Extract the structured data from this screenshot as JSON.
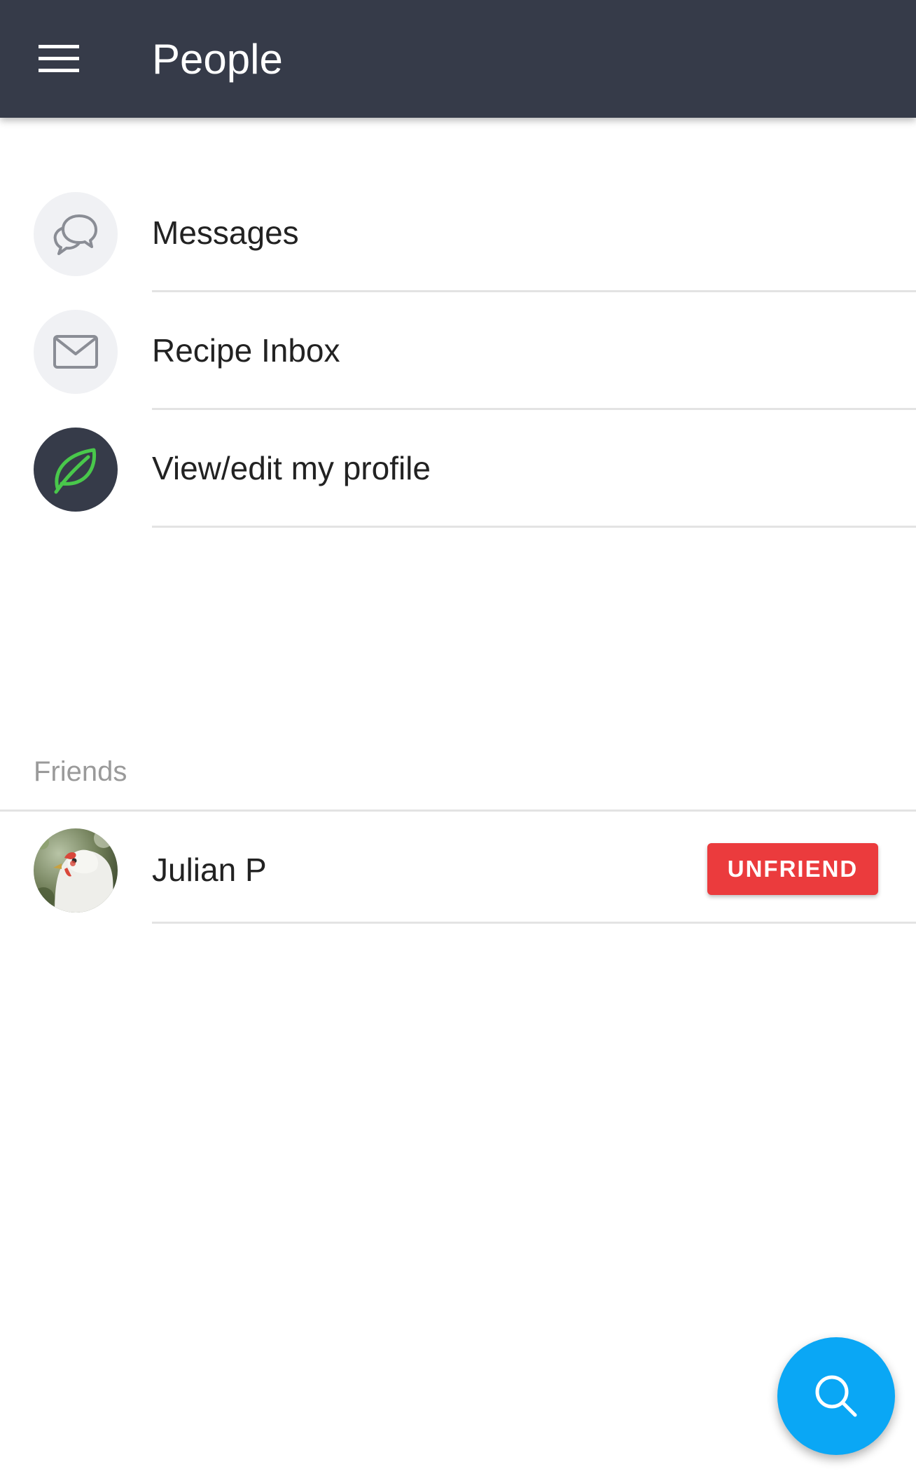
{
  "app_bar": {
    "title": "People",
    "menu_icon": "hamburger-menu-icon",
    "background": "#363b49"
  },
  "menu": {
    "items": [
      {
        "label": "Messages",
        "icon": "chat-bubbles-icon"
      },
      {
        "label": "Recipe Inbox",
        "icon": "envelope-icon"
      },
      {
        "label": "View/edit my profile",
        "icon": "leaf-icon"
      }
    ]
  },
  "friends": {
    "header": "Friends",
    "list": [
      {
        "name": "Julian P",
        "avatar": "chicken-photo-avatar",
        "action_label": "UNFRIEND"
      }
    ]
  },
  "fab": {
    "icon": "search-icon",
    "color": "#0aa7f5"
  },
  "colors": {
    "unfriend": "#eb3b3d",
    "leaf": "#49c84b"
  }
}
